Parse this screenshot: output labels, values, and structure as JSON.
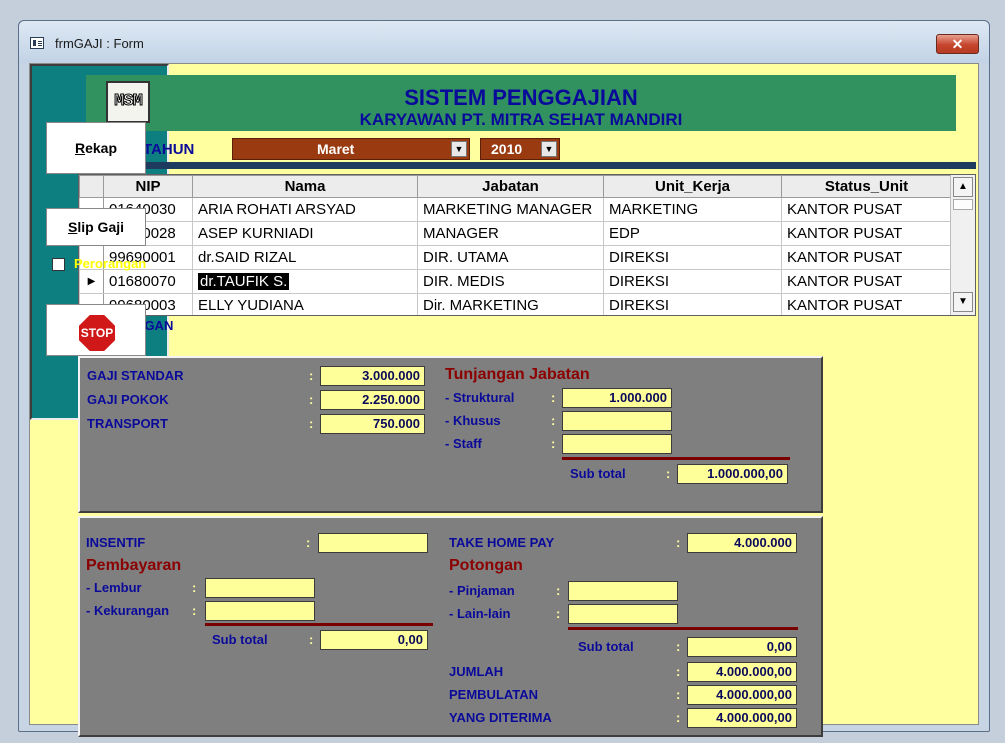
{
  "window": {
    "title": "frmGAJI : Form",
    "close_glyph": "✕"
  },
  "header": {
    "logo_text": "MSM",
    "title": "SISTEM PENGGAJIAN",
    "subtitle": "KARYAWAN PT. MITRA SEHAT MANDIRI"
  },
  "period": {
    "label": "BULAN / TAHUN",
    "bulan": "Maret",
    "tahun": "2010"
  },
  "grid": {
    "columns": [
      "NIP",
      "Nama",
      "Jabatan",
      "Unit_Kerja",
      "Status_Unit"
    ],
    "rows": [
      [
        "01640030",
        "ARIA ROHATI ARSYAD",
        "MARKETING MANAGER",
        "MARKETING",
        "KANTOR PUSAT"
      ],
      [
        "00690028",
        "ASEP KURNIADI",
        "MANAGER",
        "EDP",
        "KANTOR PUSAT"
      ],
      [
        "99690001",
        "dr.SAID RIZAL",
        "DIR. UTAMA",
        "DIREKSI",
        "KANTOR PUSAT"
      ],
      [
        "01680070",
        "dr.TAUFIK S.",
        "DIR. MEDIS",
        "DIREKSI",
        "KANTOR PUSAT"
      ],
      [
        "99680003",
        "ELLY YUDIANA",
        "Dir. MARKETING",
        "DIREKSI",
        "KANTOR PUSAT"
      ]
    ],
    "selected_row": 3
  },
  "perhitungan": {
    "label": "PERHITUNGAN",
    "gaji_standar_label": "GAJI STANDAR",
    "gaji_standar": "3.000.000",
    "gaji_pokok_label": "GAJI POKOK",
    "gaji_pokok": "2.250.000",
    "transport_label": "TRANSPORT",
    "transport": "750.000",
    "tunjangan_header": "Tunjangan Jabatan",
    "struktural_label": "- Struktural",
    "struktural": "1.000.000",
    "khusus_label": "- Khusus",
    "khusus": "",
    "staff_label": "- Staff",
    "staff": "",
    "subtotal_label": "Sub total",
    "subtotal": "1.000.000,00"
  },
  "bottom": {
    "insentif_label": "INSENTIF",
    "insentif": "",
    "pembayaran_header": "Pembayaran",
    "lembur_label": "- Lembur",
    "lembur": "",
    "kekurangan_label": "- Kekurangan",
    "kekurangan": "",
    "pembayaran_subtotal_label": "Sub total",
    "pembayaran_subtotal": "0,00",
    "thp_label": "TAKE HOME PAY",
    "thp": "4.000.000",
    "potongan_header": "Potongan",
    "pinjaman_label": "- Pinjaman",
    "pinjaman": "",
    "lainlain_label": "- Lain-lain",
    "lainlain": "",
    "potongan_subtotal_label": "Sub total",
    "potongan_subtotal": "0,00",
    "jumlah_label": "JUMLAH",
    "jumlah": "4.000.000,00",
    "pembulatan_label": "PEMBULATAN",
    "pembulatan": "4.000.000,00",
    "diterima_label": "YANG DITERIMA",
    "diterima": "4.000.000,00"
  },
  "actions": {
    "rekap_underline": "R",
    "rekap_rest": "ekap",
    "slip_underline": "S",
    "slip_rest": "lip Gaji",
    "perorangan_label": "Perorangan",
    "perorangan_checked": false,
    "stop_label": "STOP"
  },
  "colon": ":"
}
